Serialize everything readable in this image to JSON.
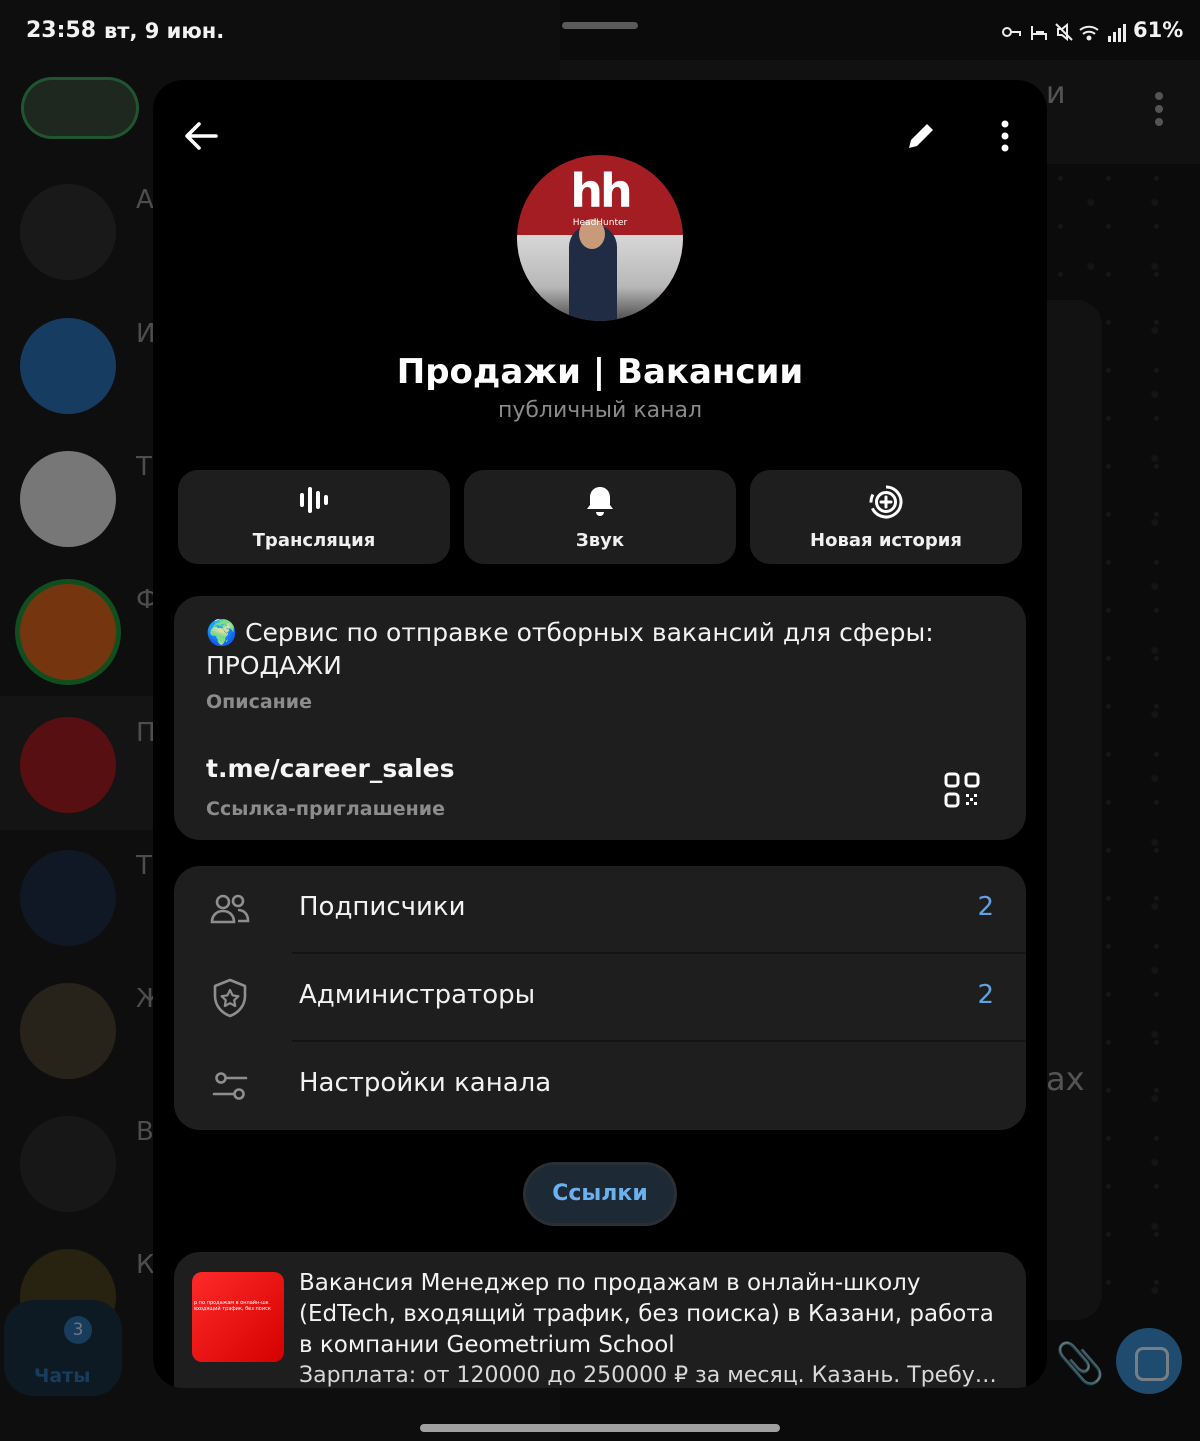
{
  "status_bar": {
    "time": "23:58",
    "date": "вт, 9 июн.",
    "battery": "61%"
  },
  "background": {
    "chat_letters": [
      "А",
      "И",
      "Т",
      "Ф",
      "П",
      "Т",
      "Ж",
      "В",
      "К"
    ],
    "header_fragment": "и",
    "bubble_fragment": "ах",
    "chats_tab_label": "Чаты",
    "chats_badge": "3"
  },
  "channel": {
    "title": "Продажи | Вакансии",
    "type_label": "публичный канал"
  },
  "actions": [
    {
      "label": "Трансляция",
      "icon": "livestream-icon"
    },
    {
      "label": "Звук",
      "icon": "bell-icon"
    },
    {
      "label": "Новая история",
      "icon": "add-story-icon"
    }
  ],
  "info": {
    "description": "🌍 Сервис по отправке отборных вакансий для сферы: ПРОДАЖИ",
    "description_label": "Описание",
    "link": "t.me/career_sales",
    "link_label": "Ссылка-приглашение"
  },
  "list": [
    {
      "label": "Подписчики",
      "count": "2",
      "icon": "subscribers-icon"
    },
    {
      "label": "Администраторы",
      "count": "2",
      "icon": "admin-shield-icon"
    },
    {
      "label": "Настройки канала",
      "count": "",
      "icon": "settings-sliders-icon"
    }
  ],
  "links_tab": "Ссылки",
  "post": {
    "title": "Вакансия Менеджер по продажам в онлайн-школу (EdTech, входящий трафик, без поиска) в Казани, работа в компании Geometrium School",
    "description": "Зарплата: от 120000 до 250000 ₽ за месяц. Казань. Требуем...",
    "thumb_text": "р по продажам в онлайн-шк входящий трафик, без поиск"
  },
  "colors": {
    "accent": "#5fa4e0",
    "card": "#1e1e1e",
    "modal": "#000000",
    "brand_hh": "#a41d22"
  }
}
